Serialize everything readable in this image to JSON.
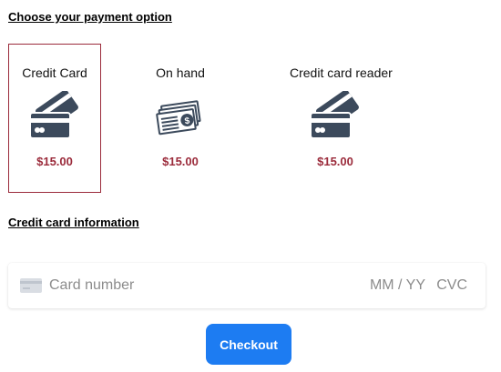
{
  "payment_section": {
    "title": "Choose your payment option",
    "options": [
      {
        "label": "Credit Card",
        "price": "$15.00",
        "icon": "credit-card-icon",
        "selected": true
      },
      {
        "label": "On hand",
        "price": "$15.00",
        "icon": "cash-icon",
        "selected": false
      },
      {
        "label": "Credit card reader",
        "price": "$15.00",
        "icon": "credit-card-icon",
        "selected": false
      }
    ]
  },
  "card_section": {
    "title": "Credit card information",
    "card_number_placeholder": "Card number",
    "expiry_placeholder": "MM / YY",
    "cvc_placeholder": "CVC",
    "card_icon": "card-placeholder-icon"
  },
  "checkout": {
    "label": "Checkout"
  },
  "colors": {
    "accent": "#9b2b3b",
    "button": "#1d7cf2",
    "icon": "#3c4a5c"
  }
}
